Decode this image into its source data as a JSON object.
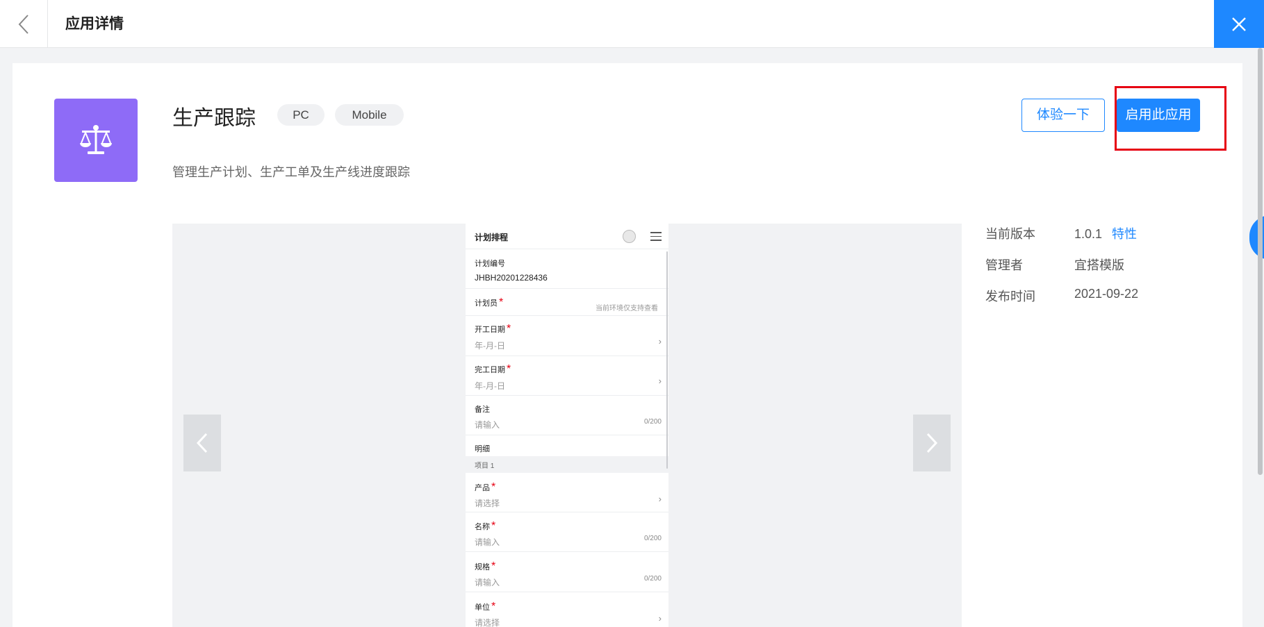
{
  "header": {
    "title": "应用详情",
    "back_icon": "chevron-left-icon",
    "close_icon": "close-icon"
  },
  "app": {
    "name": "生产跟踪",
    "icon": "balance-scale-icon",
    "icon_color": "#8e6bf7",
    "tags": [
      "PC",
      "Mobile"
    ],
    "description": "管理生产计划、生产工单及生产线进度跟踪"
  },
  "actions": {
    "try_label": "体验一下",
    "enable_label": "启用此应用",
    "accent": "#1e88ff"
  },
  "preview": {
    "form_title": "计划排程",
    "fields": [
      {
        "label": "计划编号",
        "value": "JHBH20201228436"
      },
      {
        "label": "计划员",
        "note": "当前环境仅支持查看"
      },
      {
        "label": "开工日期",
        "placeholder": "年-月-日"
      },
      {
        "label": "完工日期",
        "placeholder": "年-月-日"
      },
      {
        "label": "备注",
        "placeholder": "请输入",
        "count": "0/200"
      },
      {
        "label": "明细"
      }
    ],
    "group_label": "项目 1",
    "detail_fields": [
      {
        "label": "产品",
        "placeholder": "请选择"
      },
      {
        "label": "名称",
        "placeholder": "请输入",
        "count": "0/200"
      },
      {
        "label": "规格",
        "placeholder": "请输入",
        "count": "0/200"
      },
      {
        "label": "单位",
        "placeholder": "请选择"
      }
    ],
    "required_mark": "*",
    "chevron": "›"
  },
  "info": {
    "version_label": "当前版本",
    "version": "1.0.1",
    "features_link": "特性",
    "manager_label": "管理者",
    "manager": "宜搭模版",
    "publish_label": "发布时间",
    "publish_date": "2021-09-22"
  }
}
